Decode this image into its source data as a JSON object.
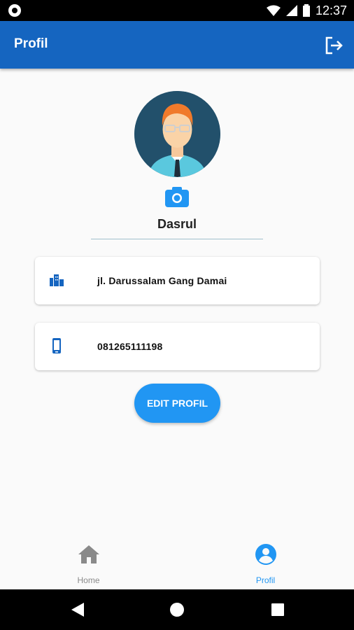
{
  "status_bar": {
    "time": "12:37",
    "battery_icon": "battery-icon",
    "wifi_icon": "wifi-icon",
    "signal_icon": "signal-icon"
  },
  "app_bar": {
    "title": "Profil",
    "logout_icon": "logout-icon",
    "color": "#1565c0"
  },
  "profile": {
    "name": "Dasrul",
    "address": "jl. Darussalam Gang Damai",
    "phone": "081265111198",
    "camera_icon": "camera-icon"
  },
  "edit_button": {
    "label": "EDIT PROFIL",
    "color": "#2196f3"
  },
  "bottom_nav": {
    "items": [
      {
        "label": "Home",
        "icon": "home-icon",
        "active": false
      },
      {
        "label": "Profil",
        "icon": "account-circle-icon",
        "active": true
      }
    ]
  },
  "system_nav": {
    "back": "back-icon",
    "home": "home-circle-icon",
    "recents": "recents-icon"
  }
}
